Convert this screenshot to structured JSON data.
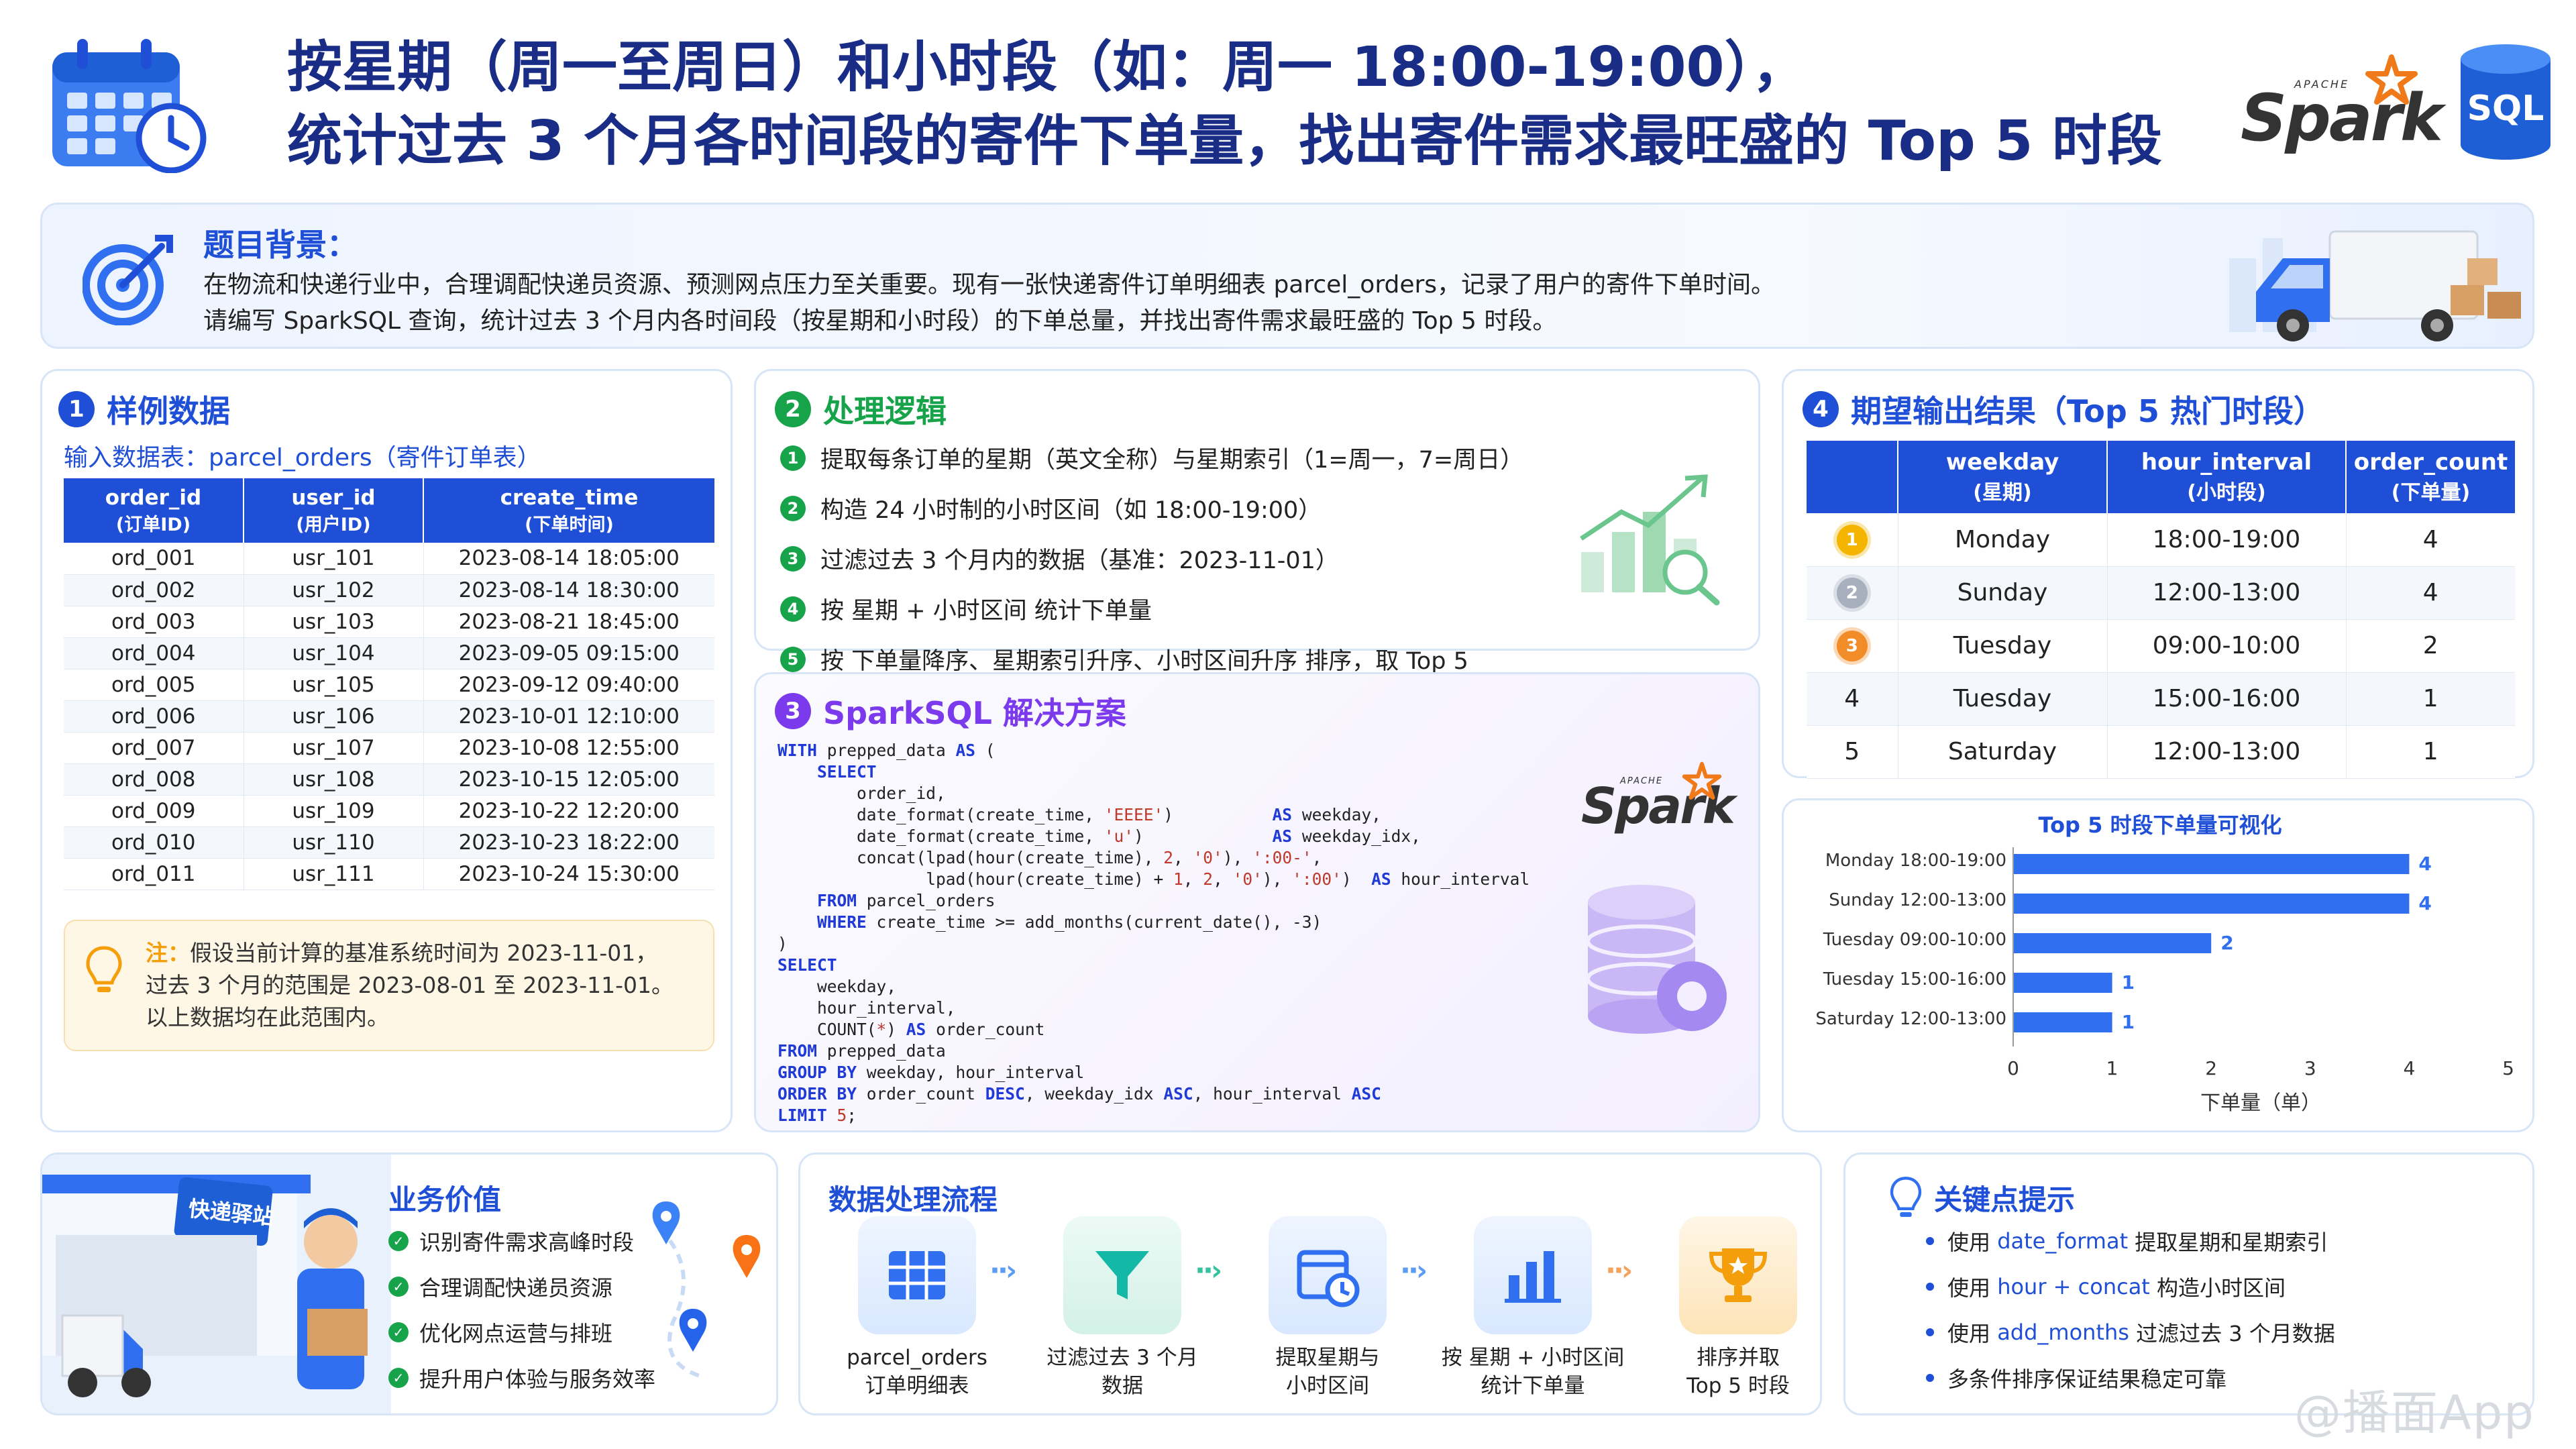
{
  "header": {
    "title_line1": "按星期（周一至周日）和小时段（如：周一 18:00-19:00），",
    "title_line2": "统计过去 3 个月各时间段的寄件下单量，找出寄件需求最旺盛的 Top 5 时段",
    "spark_logo": "Spark",
    "spark_apache": "APACHE",
    "sql_logo": "SQL"
  },
  "background": {
    "title": "题目背景：",
    "line1": "在物流和快递行业中，合理调配快递员资源、预测网点压力至关重要。现有一张快递寄件订单明细表 parcel_orders，记录了用户的寄件下单时间。",
    "line2": "请编写 SparkSQL 查询，统计过去 3 个月内各时间段（按星期和小时段）的下单总量，并找出寄件需求最旺盛的 Top 5 时段。"
  },
  "sample": {
    "num": "1",
    "title": "样例数据",
    "table_label": "输入数据表：parcel_orders（寄件订单表）",
    "headers": [
      {
        "top": "order_id",
        "sub": "(订单ID)"
      },
      {
        "top": "user_id",
        "sub": "(用户ID)"
      },
      {
        "top": "create_time",
        "sub": "(下单时间)"
      }
    ],
    "rows": [
      [
        "ord_001",
        "usr_101",
        "2023-08-14 18:05:00"
      ],
      [
        "ord_002",
        "usr_102",
        "2023-08-14 18:30:00"
      ],
      [
        "ord_003",
        "usr_103",
        "2023-08-21 18:45:00"
      ],
      [
        "ord_004",
        "usr_104",
        "2023-09-05 09:15:00"
      ],
      [
        "ord_005",
        "usr_105",
        "2023-09-12 09:40:00"
      ],
      [
        "ord_006",
        "usr_106",
        "2023-10-01 12:10:00"
      ],
      [
        "ord_007",
        "usr_107",
        "2023-10-08 12:55:00"
      ],
      [
        "ord_008",
        "usr_108",
        "2023-10-15 12:05:00"
      ],
      [
        "ord_009",
        "usr_109",
        "2023-10-22 12:20:00"
      ],
      [
        "ord_010",
        "usr_110",
        "2023-10-23 18:22:00"
      ],
      [
        "ord_011",
        "usr_111",
        "2023-10-24 15:30:00"
      ]
    ],
    "note_label": "注：",
    "note_line1": "假设当前计算的基准系统时间为 2023-11-01，",
    "note_line2": "过去 3 个月的范围是 2023-08-01 至 2023-11-01。",
    "note_line3": "以上数据均在此范围内。"
  },
  "logic": {
    "num": "2",
    "title": "处理逻辑",
    "steps": [
      "提取每条订单的星期（英文全称）与星期索引（1=周一，7=周日）",
      "构造 24 小时制的小时区间（如 18:00-19:00）",
      "过滤过去 3 个月内的数据（基准：2023-11-01）",
      "按 星期 + 小时区间 统计下单量",
      "按 下单量降序、星期索引升序、小时区间升序 排序，取 Top 5"
    ]
  },
  "solution": {
    "num": "3",
    "title": "SparkSQL 解决方案"
  },
  "results": {
    "num": "4",
    "title": "期望输出结果（Top 5 热门时段）",
    "headers": [
      {
        "top": "weekday",
        "sub": "(星期)"
      },
      {
        "top": "hour_interval",
        "sub": "(小时段)"
      },
      {
        "top": "order_count",
        "sub": "(下单量)"
      }
    ],
    "rows": [
      {
        "rank": "1",
        "weekday": "Monday",
        "hour": "18:00-19:00",
        "count": "4"
      },
      {
        "rank": "2",
        "weekday": "Sunday",
        "hour": "12:00-13:00",
        "count": "4"
      },
      {
        "rank": "3",
        "weekday": "Tuesday",
        "hour": "09:00-10:00",
        "count": "2"
      },
      {
        "rank": "4",
        "weekday": "Tuesday",
        "hour": "15:00-16:00",
        "count": "1"
      },
      {
        "rank": "5",
        "weekday": "Saturday",
        "hour": "12:00-13:00",
        "count": "1"
      }
    ]
  },
  "chart_data": {
    "type": "bar",
    "orientation": "horizontal",
    "title": "Top 5 时段下单量可视化",
    "categories": [
      "Monday 18:00-19:00",
      "Sunday 12:00-13:00",
      "Tuesday 09:00-10:00",
      "Tuesday 15:00-16:00",
      "Saturday 12:00-13:00"
    ],
    "values": [
      4,
      4,
      2,
      1,
      1
    ],
    "xlabel": "下单量（单）",
    "xlim": [
      0,
      5
    ],
    "xticks": [
      0,
      1,
      2,
      3,
      4,
      5
    ],
    "color": "#2f6ff0",
    "grid": false
  },
  "value": {
    "title": "业务价值",
    "sign": "快递驿站",
    "items": [
      "识别寄件需求高峰时段",
      "合理调配快递员资源",
      "优化网点运营与排班",
      "提升用户体验与服务效率"
    ]
  },
  "flow": {
    "title": "数据处理流程",
    "steps": [
      {
        "l1": "parcel_orders",
        "l2": "订单明细表"
      },
      {
        "l1": "过滤过去 3 个月",
        "l2": "数据"
      },
      {
        "l1": "提取星期与",
        "l2": "小时区间"
      },
      {
        "l1": "按 星期 + 小时区间",
        "l2": "统计下单量"
      },
      {
        "l1": "排序并取",
        "l2": "Top 5 时段"
      }
    ]
  },
  "tips": {
    "title": "关键点提示",
    "items": [
      {
        "pre": "使用 ",
        "hl": "date_format",
        "post": " 提取星期和星期索引"
      },
      {
        "pre": "使用 ",
        "hl": "hour + concat",
        "post": " 构造小时区间"
      },
      {
        "pre": "使用 ",
        "hl": "add_months",
        "post": " 过滤过去 3 个月数据"
      },
      {
        "pre": "",
        "hl": "",
        "post": "多条件排序保证结果稳定可靠"
      }
    ]
  },
  "watermark": "@播面App",
  "colors": {
    "primary": "#1f4fd6",
    "green": "#17a34a",
    "purple": "#7c3aed",
    "orange": "#f59e0b"
  }
}
